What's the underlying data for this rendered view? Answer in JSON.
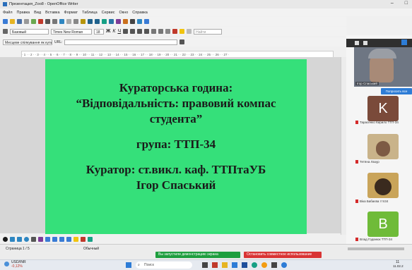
{
  "window": {
    "title": "Презентация_Zoo8 - OpenOffice Writer",
    "controls": [
      "–",
      "□"
    ]
  },
  "menu": [
    "Файл",
    "Правка",
    "Вид",
    "Вставка",
    "Формат",
    "Таблица",
    "Сервис",
    "Окно",
    "Справка"
  ],
  "format_bar": {
    "style": "Базовый",
    "font": "Times New Roman",
    "size": "18",
    "find_placeholder": "Найти"
  },
  "ruler": "· 1 · · 2 · · 3 · · 4 · · 5 · · 6 · · 7 · · 8 · · 9 · · 10 · · 11 · · 12 · · 13 · · 14 · · 15 · · 16 · · 17 · · 18 · · 19 · · 20 · · 21 · · 22 · · 23 · · 24 · · 25 · · 26 · · 27 ·",
  "slide": {
    "line1": "Кураторська година:",
    "line2": "“Відповідальність: правовий компас",
    "line3": "студента”",
    "line4": "група: ТТП-34",
    "line5": "Куратор: ст.викл. каф. ТТПтаУБ",
    "line6": "Ігор Спаський",
    "background": "#35e07a"
  },
  "status": {
    "page": "Страница 1 / 5",
    "style": "Обычный",
    "notif_green": "Вы запустили демонстрацию экрана",
    "notif_red": "Остановить совместное использование"
  },
  "taskbar": {
    "ticker_label": "USD/INR",
    "ticker_value": "-0,12%",
    "search_placeholder": "Поиск",
    "time": "11",
    "date": "11.02.2"
  },
  "conference": {
    "camera_label": "Ігор Спаський",
    "share_button": "Попросить все",
    "participants": [
      {
        "name": "Тарасенко Кирило ТТП-34",
        "initial": "K",
        "color": "#7a4a3a"
      },
      {
        "name": "Тетяна Лазур",
        "initial": "",
        "color": "#c9b38a"
      },
      {
        "name": "Віка Бабаєва ттп34",
        "initial": "",
        "color": "#c9a45a"
      },
      {
        "name": "Влад Годанюк ТТП-34",
        "initial": "B",
        "color": "#6fbb39"
      }
    ]
  }
}
